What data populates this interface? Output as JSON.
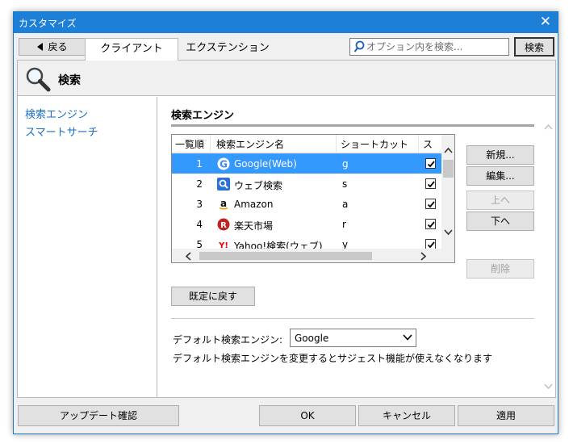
{
  "window": {
    "title": "カスタマイズ",
    "close_glyph": "✕"
  },
  "toolbar": {
    "back_label": "戻る",
    "tabs": [
      {
        "label": "クライアント",
        "active": true
      },
      {
        "label": "エクステンション",
        "active": false
      }
    ],
    "search_placeholder": "オプション内を検索...",
    "search_button": "検索"
  },
  "header": {
    "title": "検索",
    "icon": "magnifier-icon"
  },
  "sidebar": {
    "items": [
      {
        "label": "検索エンジン"
      },
      {
        "label": "スマートサーチ"
      }
    ]
  },
  "section": {
    "title": "検索エンジン"
  },
  "list": {
    "columns": [
      "一覧順",
      "検索エンジン名",
      "ショートカット",
      "スマ"
    ],
    "rows": [
      {
        "num": "1",
        "name": "Google(Web)",
        "shortcut": "g",
        "icon": "google-icon",
        "checked": true,
        "selected": true
      },
      {
        "num": "2",
        "name": "ウェブ検索",
        "shortcut": "s",
        "icon": "web-search-icon",
        "checked": true,
        "selected": false
      },
      {
        "num": "3",
        "name": "Amazon",
        "shortcut": "a",
        "icon": "amazon-icon",
        "checked": true,
        "selected": false
      },
      {
        "num": "4",
        "name": "楽天市場",
        "shortcut": "r",
        "icon": "rakuten-icon",
        "checked": true,
        "selected": false
      },
      {
        "num": "5",
        "name": "Yahoo!検索(ウェブ)",
        "shortcut": "y",
        "icon": "yahoo-icon",
        "checked": true,
        "selected": false
      }
    ]
  },
  "side_buttons": {
    "new": "新規...",
    "edit": "編集...",
    "up": "上へ",
    "down": "下へ",
    "delete": "削除"
  },
  "reset_button": "既定に戻す",
  "default_engine": {
    "label": "デフォルト検索エンジン:",
    "value": "Google",
    "note": "デフォルト検索エンジンを変更するとサジェスト機能が使えなくなります"
  },
  "footer": {
    "update": "アップデート確認",
    "ok": "OK",
    "cancel": "キャンセル",
    "apply": "適用"
  },
  "colors": {
    "accent": "#1e7fd6",
    "selection": "#3399ff",
    "link": "#1a6ec6"
  }
}
